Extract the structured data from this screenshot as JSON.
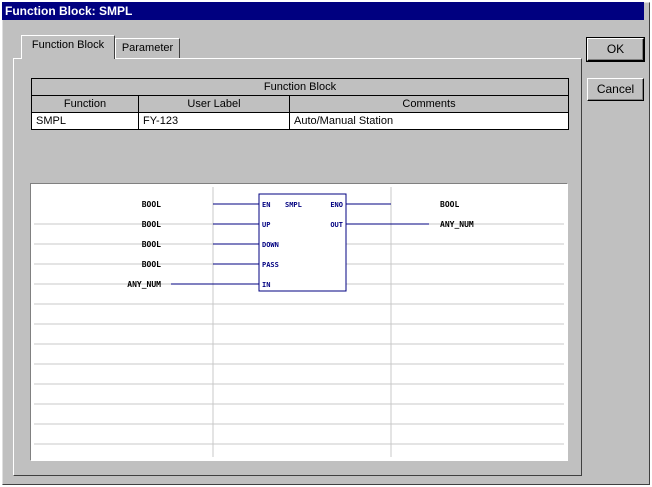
{
  "window": {
    "title": "Function Block: SMPL"
  },
  "tabs": [
    {
      "label": "Function Block",
      "active": true
    },
    {
      "label": "Parameter",
      "active": false
    }
  ],
  "buttons": {
    "ok": "OK",
    "cancel": "Cancel"
  },
  "table": {
    "group_header": "Function Block",
    "columns": [
      "Function",
      "User Label",
      "Comments"
    ],
    "rows": [
      [
        "SMPL",
        "FY-123",
        "Auto/Manual Station"
      ]
    ]
  },
  "diagram": {
    "block": {
      "name": "SMPL",
      "inputs": [
        "EN",
        "UP",
        "DOWN",
        "PASS",
        "IN"
      ],
      "outputs": [
        "ENO",
        "OUT"
      ]
    },
    "input_types": [
      "BOOL",
      "BOOL",
      "BOOL",
      "BOOL",
      "ANY_NUM"
    ],
    "output_types": [
      "BOOL",
      "ANY_NUM"
    ]
  },
  "colors": {
    "titlebar": "#000080",
    "wire": "#000080",
    "pin_text": "#000080"
  }
}
